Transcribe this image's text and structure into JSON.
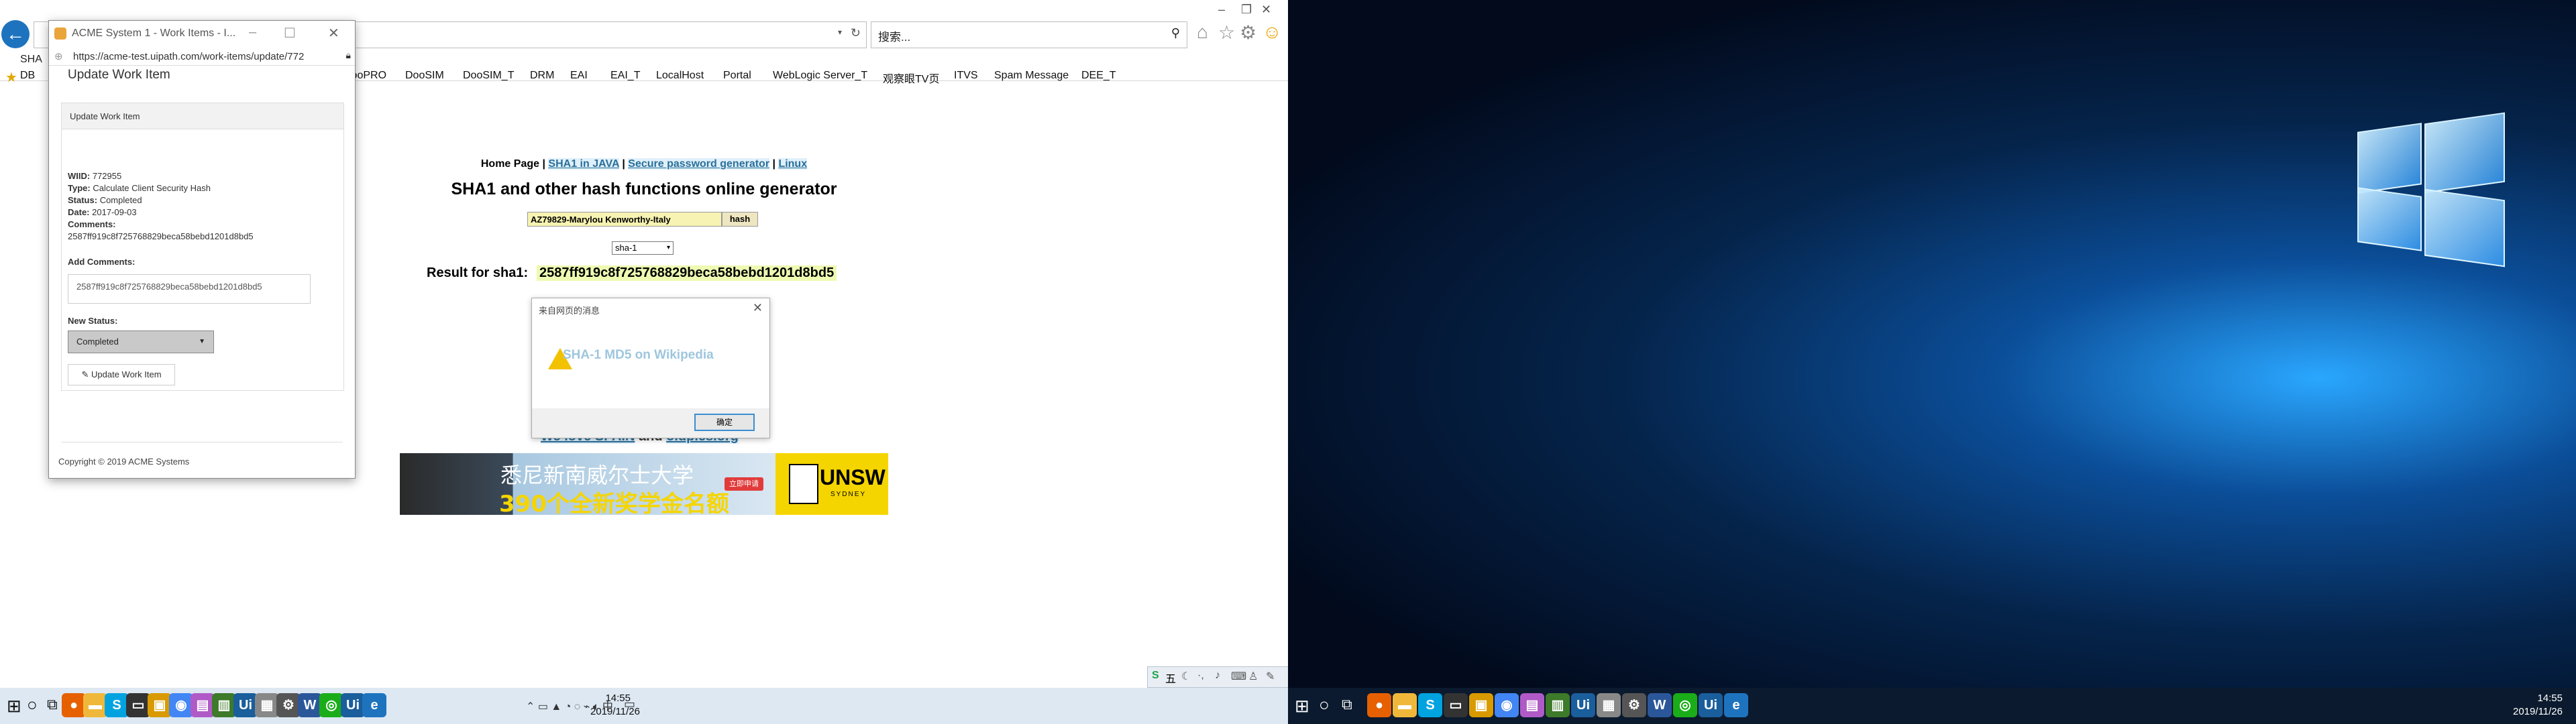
{
  "ie": {
    "url": "",
    "search_placeholder": "搜索...",
    "tab_title": "SHA",
    "favorites": [
      "DB",
      "DooPRO",
      "DooSIM",
      "DooSIM_T",
      "DRM",
      "EAI",
      "EAI_T",
      "LocalHost",
      "Portal",
      "WebLogic Server_T",
      "观察眼TV页",
      "ITVS",
      "Spam Message",
      "DEE_T"
    ]
  },
  "page": {
    "nav": {
      "home": "Home Page",
      "sep": "|",
      "sha1_java": "SHA1 in JAVA",
      "secure_pw": "Secure password generator",
      "linux": "Linux"
    },
    "heading": "SHA1 and other hash functions online generator",
    "input_value": "AZ79829-Marylou Kenworthy-Italy",
    "hash_button": "hash",
    "algorithm": "sha-1",
    "result_label": "Result for sha1:",
    "result_value": "2587ff919c8f725768829beca58bebd1201d8bd5",
    "love_prefix": "We love SPAIN",
    "love_and": "and",
    "love_link": "oldpics.org",
    "ad": {
      "line1": "悉尼新南威尔士大学",
      "line2": "390个全新奖学金名额",
      "btn": "立即申请",
      "unsw": "UNSW",
      "sydney": "SYDNEY"
    }
  },
  "dialog": {
    "title": "来自网页的消息",
    "message": "SHA-1 MD5 on Wikipedia",
    "ok": "确定"
  },
  "acme": {
    "window_title": "ACME System 1 - Work Items - I...",
    "url": "https://acme-test.uipath.com/work-items/update/772",
    "panel_header": "Update Work Item",
    "title": "Update Work Item",
    "wiid_label": "WIID:",
    "wiid": "772955",
    "type_label": "Type:",
    "type": "Calculate Client Security Hash",
    "status_label": "Status:",
    "status": "Completed",
    "date_label": "Date:",
    "date": "2017-09-03",
    "comments_label": "Comments:",
    "comments": "2587ff919c8f725768829beca58bebd1201d8bd5",
    "add_comments_label": "Add Comments:",
    "add_comments_value": "2587ff919c8f725768829beca58bebd1201d8bd5",
    "new_status_label": "New Status:",
    "new_status": "Completed",
    "update_button": "Update Work Item",
    "copyright": "Copyright © 2019 ACME Systems"
  },
  "taskbar_left": {
    "time": "14:55",
    "date": "2019/11/26",
    "ime": "五"
  },
  "taskbar_right": {
    "time": "14:55",
    "date": "2019/11/26"
  },
  "colors": {
    "ie_accent": "#1e73be",
    "taskbar_light": "#dde8f2",
    "taskbar_dark": "#0b1a2e",
    "result_bg": "#eefab2"
  }
}
